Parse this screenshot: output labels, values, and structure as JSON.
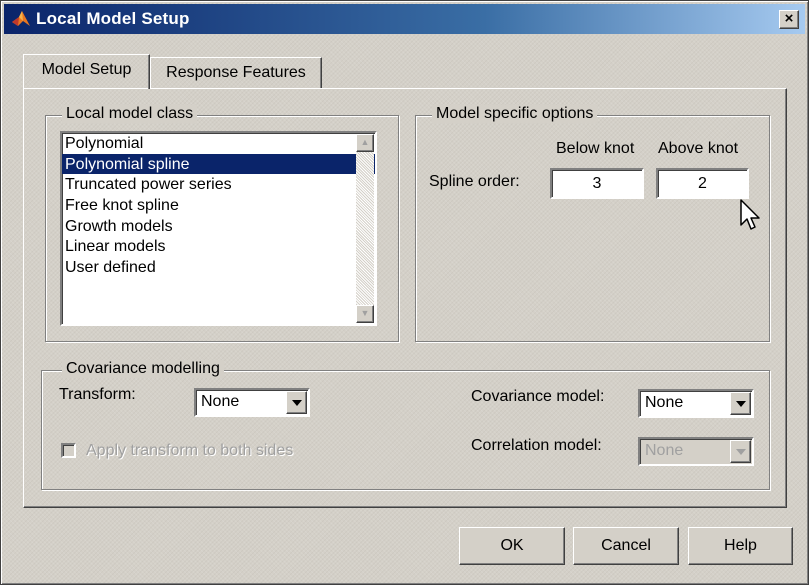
{
  "window": {
    "title": "Local Model Setup",
    "close_label": "×"
  },
  "tabs": [
    {
      "label": "Model Setup",
      "active": true
    },
    {
      "label": "Response Features",
      "active": false
    }
  ],
  "local_model": {
    "legend": "Local model class",
    "items": [
      {
        "label": "Polynomial",
        "selected": false
      },
      {
        "label": "Polynomial spline",
        "selected": true
      },
      {
        "label": "Truncated power series",
        "selected": false
      },
      {
        "label": "Free knot spline",
        "selected": false
      },
      {
        "label": "Growth models",
        "selected": false
      },
      {
        "label": "Linear models",
        "selected": false
      },
      {
        "label": "User defined",
        "selected": false
      }
    ]
  },
  "model_options": {
    "legend": "Model specific options",
    "below_knot_label": "Below knot",
    "above_knot_label": "Above knot",
    "spline_order_label": "Spline order:",
    "below_value": "3",
    "above_value": "2"
  },
  "covariance": {
    "legend": "Covariance modelling",
    "transform_label": "Transform:",
    "transform_value": "None",
    "apply_transform_label": "Apply transform to both sides",
    "apply_transform_checked": false,
    "covariance_model_label": "Covariance model:",
    "covariance_model_value": "None",
    "correlation_model_label": "Correlation model:",
    "correlation_model_value": "None"
  },
  "buttons": {
    "ok": "OK",
    "cancel": "Cancel",
    "help": "Help"
  },
  "icons": [
    "matlab-logo-icon",
    "close-icon",
    "scroll-up-icon",
    "scroll-down-icon",
    "chevron-down-icon",
    "mouse-pointer-icon"
  ]
}
